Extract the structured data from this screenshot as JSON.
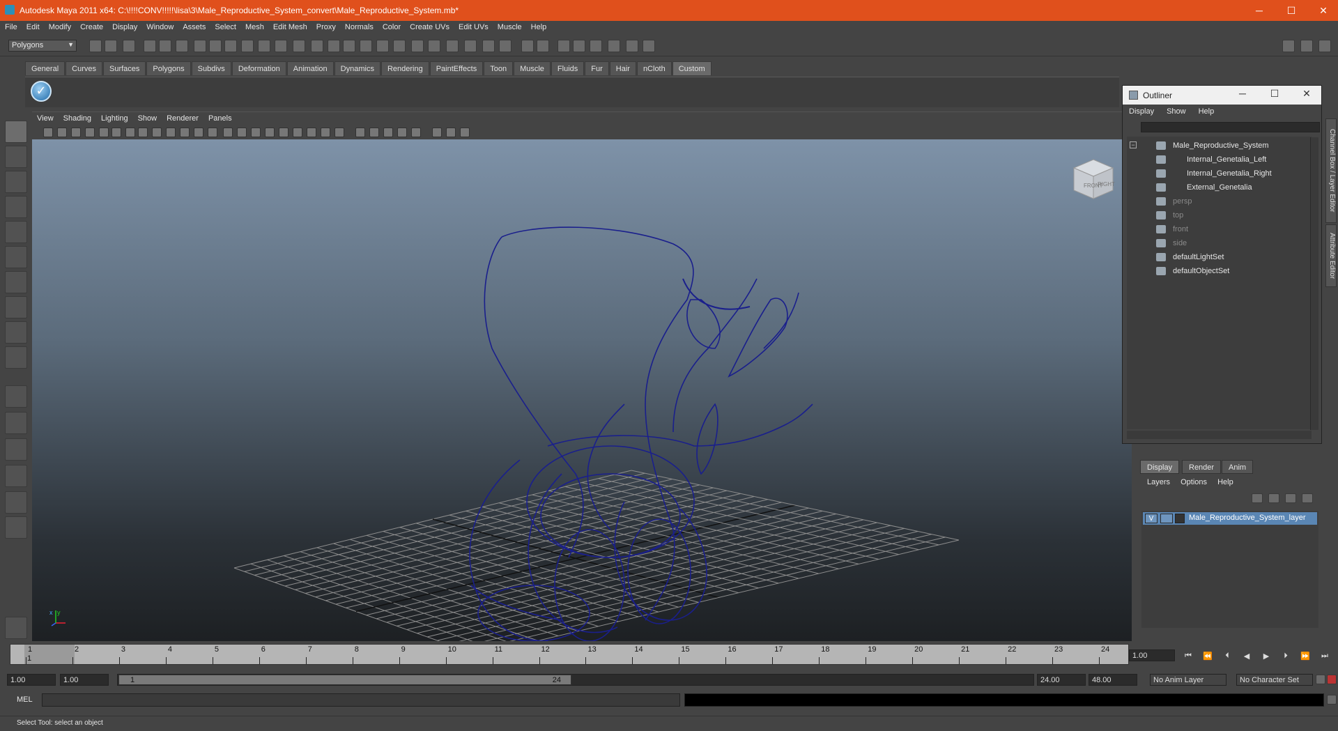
{
  "title_bar": {
    "title": "Autodesk Maya 2011 x64: C:\\!!!!CONV!!!!!\\lisa\\3\\Male_Reproductive_System_convert\\Male_Reproductive_System.mb*",
    "minimize": "─",
    "maximize": "☐",
    "close": "✕"
  },
  "menus": [
    "File",
    "Edit",
    "Modify",
    "Create",
    "Display",
    "Window",
    "Assets",
    "Select",
    "Mesh",
    "Edit Mesh",
    "Proxy",
    "Normals",
    "Color",
    "Create UVs",
    "Edit UVs",
    "Muscle",
    "Help"
  ],
  "mode_selector": {
    "value": "Polygons"
  },
  "shelf_tabs": [
    "General",
    "Curves",
    "Surfaces",
    "Polygons",
    "Subdivs",
    "Deformation",
    "Animation",
    "Dynamics",
    "Rendering",
    "PaintEffects",
    "Toon",
    "Muscle",
    "Fluids",
    "Fur",
    "Hair",
    "nCloth",
    "Custom"
  ],
  "shelf_active": "Custom",
  "viewport_menu": [
    "View",
    "Shading",
    "Lighting",
    "Show",
    "Renderer",
    "Panels"
  ],
  "viewcube": {
    "front": "FRONT",
    "right": "RIGHT"
  },
  "axis": {
    "x": "x",
    "y": "y"
  },
  "outliner": {
    "title": "Outliner",
    "menu": [
      "Display",
      "Show",
      "Help"
    ],
    "items": [
      {
        "label": "Male_Reproductive_System",
        "depth": 0,
        "dim": false
      },
      {
        "label": "Internal_Genetalia_Left",
        "depth": 1,
        "dim": false
      },
      {
        "label": "Internal_Genetalia_Right",
        "depth": 1,
        "dim": false
      },
      {
        "label": "External_Genetalia",
        "depth": 1,
        "dim": false
      },
      {
        "label": "persp",
        "depth": 0,
        "dim": true
      },
      {
        "label": "top",
        "depth": 0,
        "dim": true
      },
      {
        "label": "front",
        "depth": 0,
        "dim": true
      },
      {
        "label": "side",
        "depth": 0,
        "dim": true
      },
      {
        "label": "defaultLightSet",
        "depth": 0,
        "dim": false
      },
      {
        "label": "defaultObjectSet",
        "depth": 0,
        "dim": false
      }
    ]
  },
  "right_dock_tabs": [
    "Channel Box / Layer Editor",
    "Attribute Editor"
  ],
  "layer_editor": {
    "tabs": [
      "Display",
      "Render",
      "Anim"
    ],
    "active_tab": "Display",
    "menu": [
      "Layers",
      "Options",
      "Help"
    ],
    "layer": {
      "visible": "V",
      "name": "Male_Reproductive_System_layer"
    }
  },
  "time_slider": {
    "ticks": [
      "1",
      "2",
      "3",
      "4",
      "5",
      "6",
      "7",
      "8",
      "9",
      "10",
      "11",
      "12",
      "13",
      "14",
      "15",
      "16",
      "17",
      "18",
      "19",
      "20",
      "21",
      "22",
      "23",
      "24"
    ],
    "current_marker": "1",
    "current_frame": "1.00"
  },
  "range": {
    "start": "1.00",
    "playback_start": "1.00",
    "handle_start": "1",
    "handle_end": "24",
    "playback_end": "24.00",
    "end": "48.00",
    "anim_layer": "No Anim Layer",
    "character_set": "No Character Set"
  },
  "command_line": {
    "label": "MEL"
  },
  "help_line": {
    "text": "Select Tool: select an object"
  }
}
